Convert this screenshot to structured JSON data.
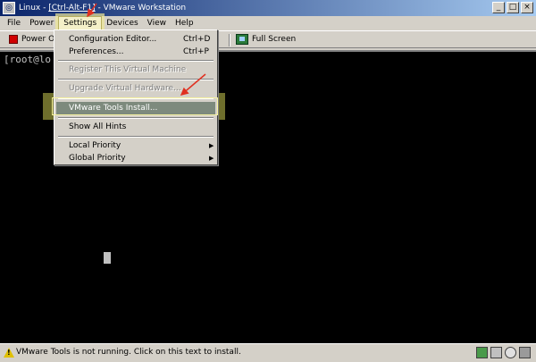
{
  "window": {
    "title_prefix": "Linux - ",
    "title_highlight": "[Ctrl-Alt-F1]",
    "title_suffix": " - VMware Workstation",
    "minimize": "_",
    "maximize": "□",
    "close": "×"
  },
  "menubar": {
    "items": [
      {
        "label": "File"
      },
      {
        "label": "Power"
      },
      {
        "label": "Settings"
      },
      {
        "label": "Devices"
      },
      {
        "label": "View"
      },
      {
        "label": "Help"
      }
    ]
  },
  "toolbar": {
    "power_label": "Power O",
    "fullscreen_label": "Full Screen"
  },
  "console": {
    "prompt": "[root@lo"
  },
  "settings_menu": {
    "items": [
      {
        "label": "Configuration Editor...",
        "shortcut": "Ctrl+D"
      },
      {
        "label": "Preferences...",
        "shortcut": "Ctrl+P"
      },
      {
        "label": "Register This Virtual Machine"
      },
      {
        "label": "Upgrade Virtual Hardware..."
      },
      {
        "label": "VMware Tools Install..."
      },
      {
        "label": "Show All Hints"
      },
      {
        "label": "Local Priority",
        "arrow": "▶"
      },
      {
        "label": "Global Priority",
        "arrow": "▶"
      }
    ]
  },
  "statusbar": {
    "text": "VMware Tools is not running. Click on this text to install."
  },
  "colors": {
    "title_gradient_start": "#0a246a",
    "title_gradient_end": "#a6caf0",
    "highlight": "#c8c850",
    "annotation_arrow": "#e03020"
  }
}
